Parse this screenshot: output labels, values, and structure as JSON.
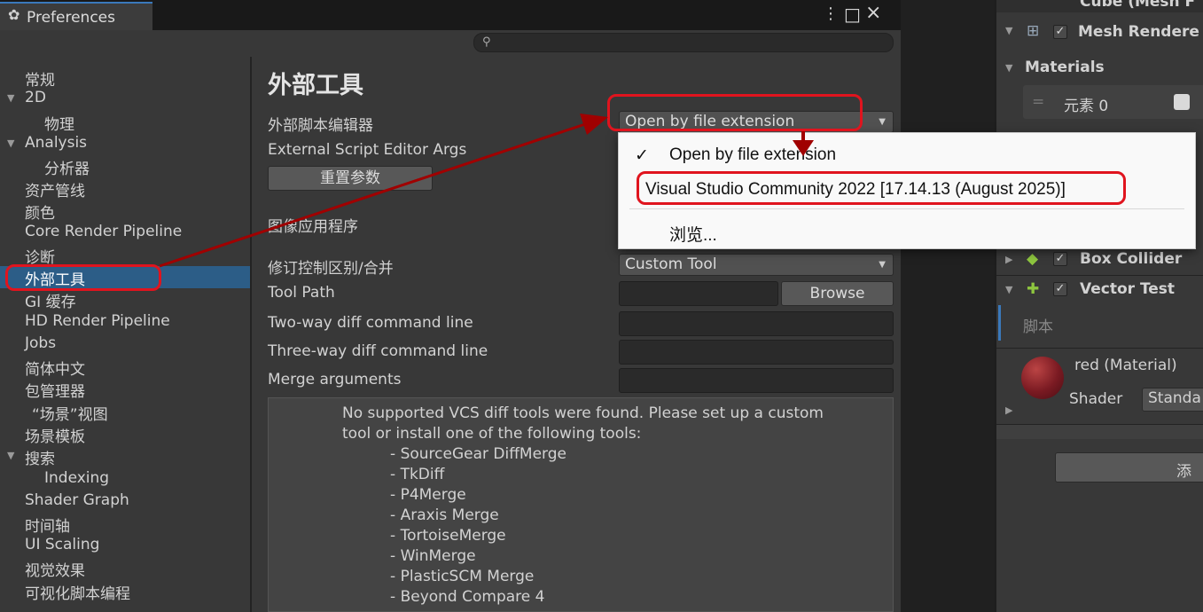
{
  "window": {
    "tab_title": "Preferences",
    "menu_icon": "⋮",
    "maximize_icon": "□",
    "close_icon": "×"
  },
  "sidebar": {
    "items": [
      {
        "label": "常规"
      },
      {
        "label": "2D"
      },
      {
        "label": "物理"
      },
      {
        "label": "Analysis"
      },
      {
        "label": "分析器"
      },
      {
        "label": "资产管线"
      },
      {
        "label": "颜色"
      },
      {
        "label": "Core Render Pipeline"
      },
      {
        "label": "诊断"
      },
      {
        "label": "外部工具"
      },
      {
        "label": "GI 缓存"
      },
      {
        "label": "HD Render Pipeline"
      },
      {
        "label": "Jobs"
      },
      {
        "label": "简体中文"
      },
      {
        "label": "包管理器"
      },
      {
        "label": "“场景”视图"
      },
      {
        "label": "场景模板"
      },
      {
        "label": "搜索"
      },
      {
        "label": "Indexing"
      },
      {
        "label": "Shader Graph"
      },
      {
        "label": "时间轴"
      },
      {
        "label": "UI Scaling"
      },
      {
        "label": "视觉效果"
      },
      {
        "label": "可视化脚本编程"
      }
    ]
  },
  "main": {
    "title": "外部工具",
    "script_editor_label": "外部脚本编辑器",
    "script_editor_value": "Open by file extension",
    "editor_args_label": "External Script Editor Args",
    "reset_button": "重置参数",
    "image_app_label": "图像应用程序",
    "revision_label": "修订控制区别/合并",
    "revision_value": "Custom Tool",
    "tool_path_label": "Tool Path",
    "browse_button": "Browse",
    "two_way_label": "Two-way diff command line",
    "three_way_label": "Three-way diff command line",
    "merge_args_label": "Merge arguments",
    "vcs_message": "No supported VCS diff tools were found. Please set up a custom\ntool or install one of the following tools:\n          - SourceGear DiffMerge\n          - TkDiff\n          - P4Merge\n          - Araxis Merge\n          - TortoiseMerge\n          - WinMerge\n          - PlasticSCM Merge\n          - Beyond Compare 4"
  },
  "popup": {
    "items": [
      {
        "label": "Open by file extension",
        "checked": true
      },
      {
        "label": "Visual Studio Community 2022 [17.14.13 (August 2025)]",
        "checked": false
      },
      {
        "label": "浏览...",
        "checked": false
      }
    ],
    "check_mark": "✓"
  },
  "inspector": {
    "cube_label": "Cube (Mesh F",
    "mesh_renderer": "Mesh Rendere",
    "materials": "Materials",
    "element0": "元素 0",
    "box_collider": "Box Collider",
    "vector_test": "Vector Test",
    "script_label": "脚本",
    "material_name": "red (Material)",
    "shader_label": "Shader",
    "shader_value": "Standa",
    "add_button": "添"
  },
  "colors": {
    "accent_selection": "#2c5d87",
    "annotation_red": "#e0141e",
    "arrow_red": "#a00000"
  }
}
